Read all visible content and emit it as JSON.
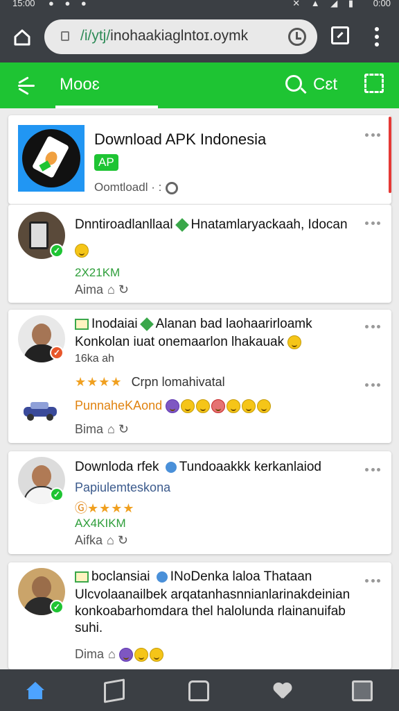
{
  "status": {
    "time_left": "15:00",
    "time_right": "0:00"
  },
  "browser": {
    "url_green": "/i/ytj/",
    "url_rest": "inohaakiaglntoɪ.oymk"
  },
  "appbar": {
    "title": "Mooɛ",
    "cell_label": "Cɛt"
  },
  "featured": {
    "title": "Download APK Indonesia",
    "badge": "AP",
    "subtitle": "Oomtloadl · :"
  },
  "posts": [
    {
      "title": "Dnntiroadlanllaal",
      "title_rest": "Hnatamlaryackaah, Idocan",
      "emoji_line": "",
      "green": "2X21KM",
      "meta": "Aima"
    },
    {
      "title_a": "Inodaiai",
      "title_b": "Alanan bad laohaarirloamk",
      "body": "Konkolan iuat onemaarlon lhakauak",
      "small": "16ka ah",
      "stars": "★★★★",
      "stars_text": "Crpn lomahivatal",
      "orange": "PunnaheKAond",
      "meta": "Bima"
    },
    {
      "title_a": "Downloda rfek",
      "title_b": "Tundoaakkk kerkanlaiod",
      "blue": "Papiulemteskona",
      "stars": "★★★★",
      "green": "AX4KIKM",
      "meta": "Aifka"
    },
    {
      "title_a": "boclansiai",
      "title_b": "INoDenka laloa Thataan",
      "body1": "Ulcvolaanailbek arqatanhasnnianlarinakdeinian",
      "body2": "konkoabarhomdara thel halolunda rlainanuifab",
      "body3": "suhi.",
      "meta": "Dima"
    }
  ]
}
